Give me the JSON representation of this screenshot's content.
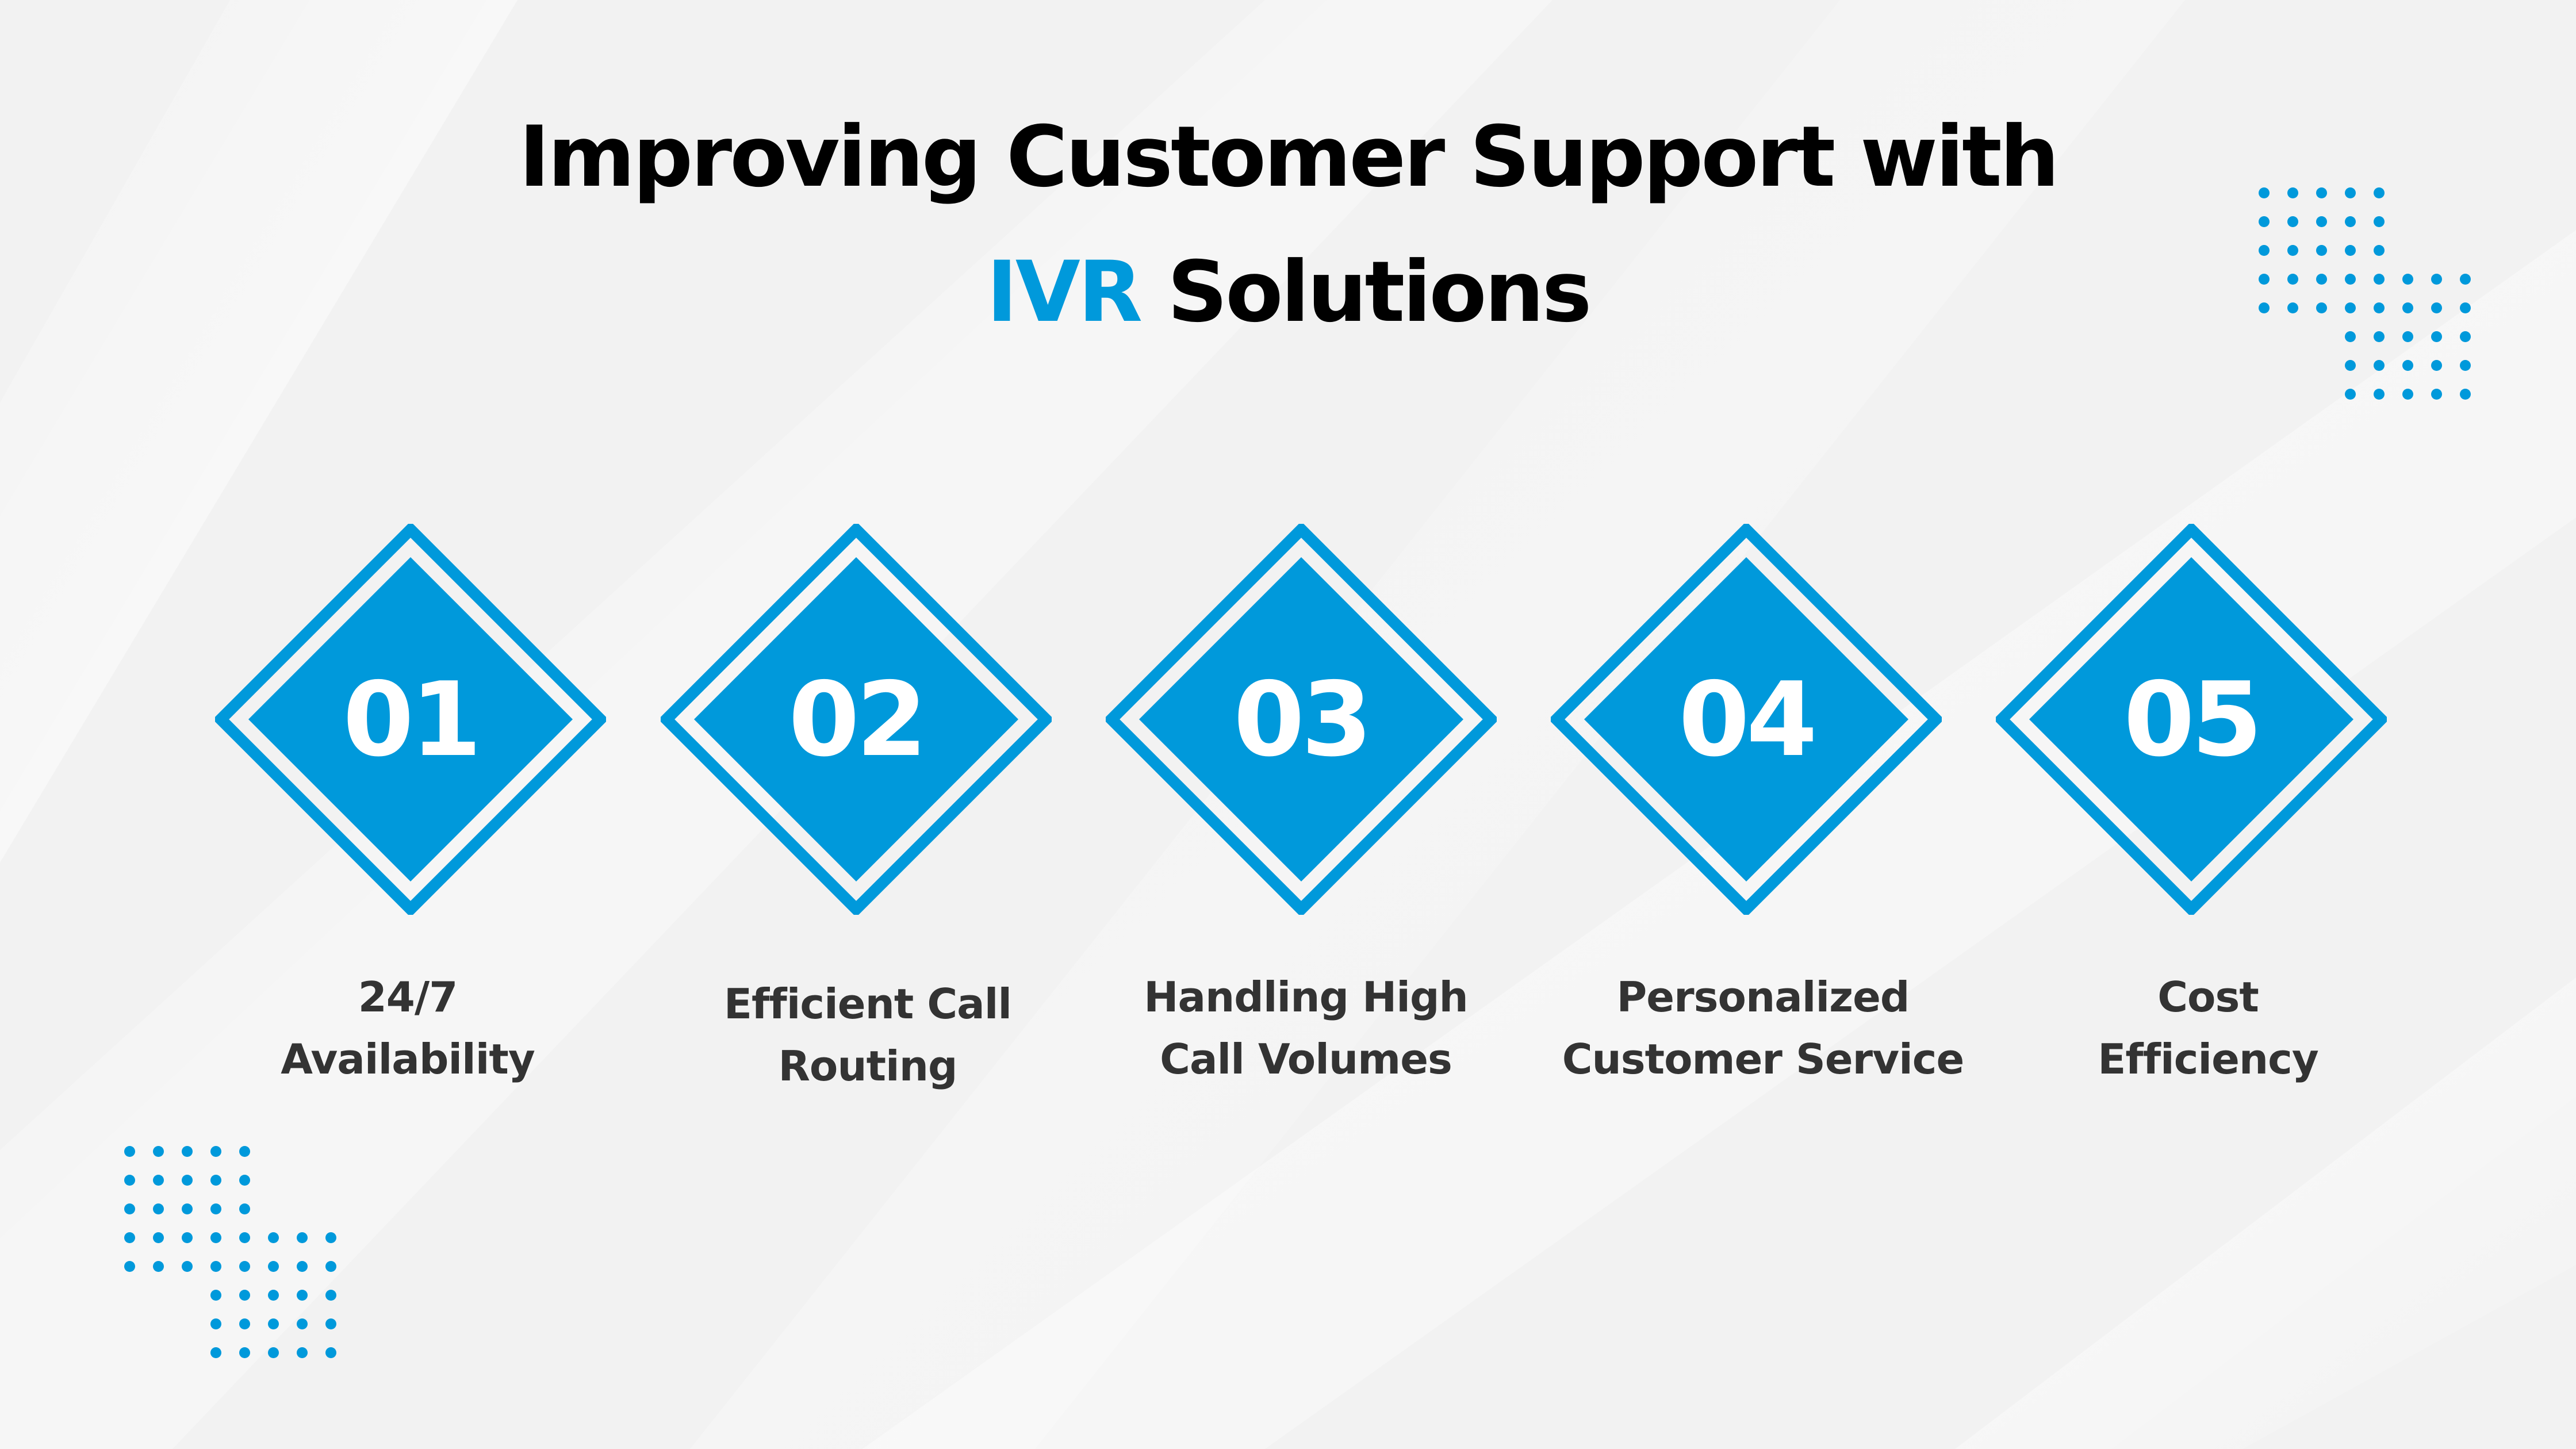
{
  "title": {
    "line1": "Improving Customer Support with",
    "line2_accent": "IVR",
    "line2_rest": " Solutions"
  },
  "colors": {
    "accent": "#0099db",
    "title_text": "#000000",
    "label_text": "#333333",
    "background": "#f2f2f2",
    "number_text": "#ffffff"
  },
  "steps": [
    {
      "number": "01",
      "label_lines": [
        "24/7",
        "Availability"
      ]
    },
    {
      "number": "02",
      "label_lines": [
        "Efficient Call",
        "Routing"
      ]
    },
    {
      "number": "03",
      "label_lines": [
        "Handling High",
        "Call Volumes"
      ]
    },
    {
      "number": "04",
      "label_lines": [
        "Personalized",
        "Customer Service"
      ]
    },
    {
      "number": "05",
      "label_lines": [
        "Cost",
        "Efficiency"
      ]
    }
  ],
  "decorations": {
    "top_right": "dot-grid-icon",
    "bottom_left": "dot-grid-icon"
  }
}
